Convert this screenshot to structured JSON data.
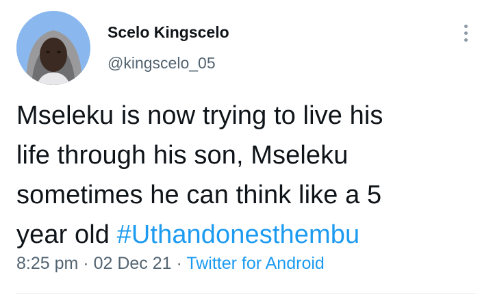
{
  "author": {
    "display_name": "Scelo Kingscelo",
    "handle": "@kingscelo_05"
  },
  "tweet": {
    "lines": [
      "Mseleku is now trying to live his",
      "life through his son, Mseleku",
      "sometimes he can think like a 5"
    ],
    "last_line_text": "year old ",
    "hashtag": "#Uthandonesthembu"
  },
  "meta": {
    "time": "8:25 pm",
    "separator": "·",
    "date": "02 Dec 21",
    "source": "Twitter for Android"
  },
  "colors": {
    "accent": "#1d9bf0",
    "secondary_text": "#536471",
    "primary_text": "#0f1419"
  },
  "icons": {
    "more": "more-vertical-icon"
  }
}
